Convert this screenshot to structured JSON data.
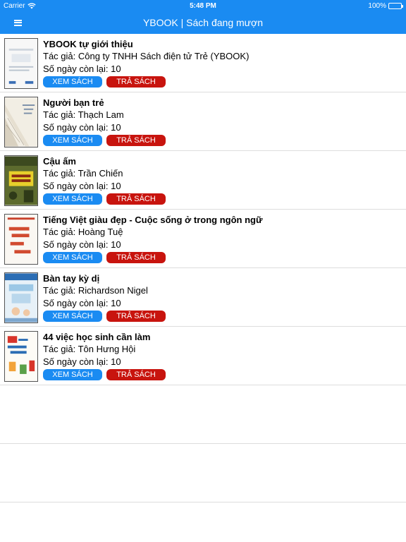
{
  "status": {
    "carrier": "Carrier",
    "time": "5:48 PM",
    "battery": "100%"
  },
  "nav": {
    "title": "YBOOK | Sách đang mượn"
  },
  "books": [
    {
      "title": "YBOOK tự giới thiệu",
      "author": "Tác giả: Công ty TNHH Sách điện tử Trẻ (YBOOK)",
      "days": "Số ngày còn lại: 10",
      "view_label": "XEM SÁCH",
      "return_label": "TRẢ SÁCH",
      "cover_text": "YBOOK"
    },
    {
      "title": "Người bạn trẻ",
      "author": "Tác giả: Thạch Lam",
      "days": "Số ngày còn lại: 10",
      "view_label": "XEM SÁCH",
      "return_label": "TRẢ SÁCH",
      "cover_text": "Người bạn trẻ"
    },
    {
      "title": "Cậu ấm",
      "author": "Tác giả: Trần Chiến",
      "days": "Số ngày còn lại: 10",
      "view_label": "XEM SÁCH",
      "return_label": "TRẢ SÁCH",
      "cover_text": "CẬU ẤM"
    },
    {
      "title": "Tiếng Việt giàu đẹp - Cuộc sống ở trong ngôn ngữ",
      "author": "Tác giả: Hoàng Tuệ",
      "days": "Số ngày còn lại: 10",
      "view_label": "XEM SÁCH",
      "return_label": "TRẢ SÁCH",
      "cover_text": "Cuộc sống ngôn ngữ"
    },
    {
      "title": "Bàn tay kỳ dị",
      "author": "Tác giả: Richardson Nigel",
      "days": "Số ngày còn lại: 10",
      "view_label": "XEM SÁCH",
      "return_label": "TRẢ SÁCH",
      "cover_text": "Bàn tay kỳ dị"
    },
    {
      "title": "44 việc học sinh cần làm",
      "author": "Tác giả: Tôn Hưng Hội",
      "days": "Số ngày còn lại: 10",
      "view_label": "XEM SÁCH",
      "return_label": "TRẢ SÁCH",
      "cover_text": "44 việc học sinh cần làm"
    }
  ],
  "colors": {
    "accent": "#1a8bf2",
    "danger": "#c8140e",
    "divider": "#dddddd"
  }
}
